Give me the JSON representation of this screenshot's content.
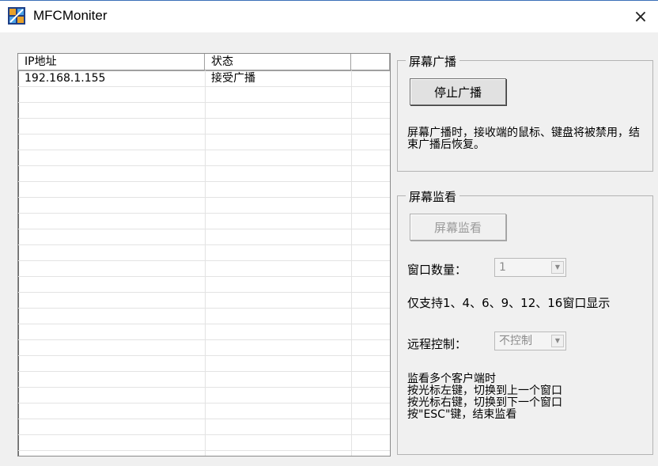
{
  "window": {
    "title": "MFCMoniter",
    "close_glyph": "×"
  },
  "list": {
    "columns": [
      "IP地址",
      "状态",
      ""
    ],
    "rows": [
      {
        "ip": "192.168.1.155",
        "status": "接受广播"
      }
    ]
  },
  "broadcast": {
    "group_title": "屏幕广播",
    "button_label": "停止广播",
    "note": "屏幕广播时，接收端的鼠标、键盘将被禁用，结束广播后恢复。"
  },
  "monitor": {
    "group_title": "屏幕监看",
    "button_label": "屏幕监看",
    "window_count_label": "窗口数量：",
    "window_count_value": "1",
    "support_text": "仅支持1、4、6、9、12、16窗口显示",
    "remote_label": "远程控制：",
    "remote_value": "不控制",
    "help_lines": [
      "监看多个客户端时",
      "按光标左键，切换到上一个窗口",
      "按光标右键，切换到下一个窗口",
      "按\"ESC\"键，结束监看"
    ]
  },
  "colors": {
    "accent": "#3b6fb8",
    "background": "#f0f0f0"
  },
  "icons": {
    "app": "app-icon",
    "close": "close-icon",
    "dropdown": "chevron-down-icon"
  }
}
